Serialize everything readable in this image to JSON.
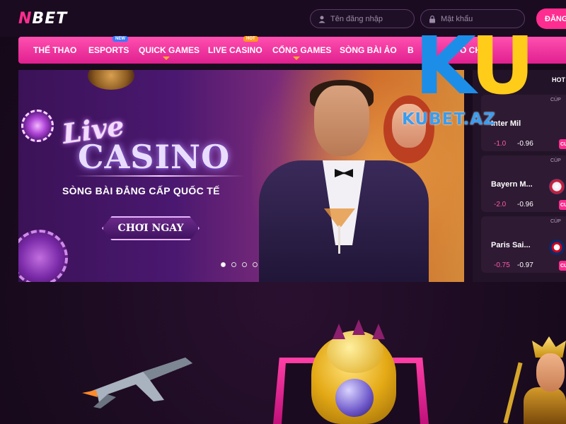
{
  "header": {
    "logo_text": "BET",
    "logo_mark": "N",
    "username_placeholder": "Tên đăng nhập",
    "password_placeholder": "Mật khẩu",
    "login_label": "ĐĂNG"
  },
  "nav": {
    "items": [
      {
        "label": "THỂ THAO"
      },
      {
        "label": "ESPORTS",
        "badge": "NEW"
      },
      {
        "label": "QUICK GAMES"
      },
      {
        "label": "LIVE CASINO",
        "badge": "HOT"
      },
      {
        "label": "CỔNG GAMES"
      },
      {
        "label": "SÒNG BÀI ẢO"
      },
      {
        "label": "B"
      },
      {
        "label": "O CHƠI"
      }
    ]
  },
  "banner": {
    "title_script": "Live",
    "title_main": "CASINO",
    "subtitle": "SÒNG BÀI ĐẲNG CẤP QUỐC TẾ",
    "cta_label": "CHƠI NGAY",
    "slide_count": 4,
    "active_slide": 1
  },
  "hot_panel": {
    "title": "HOT",
    "matches": [
      {
        "cup": "CÚP",
        "team": "Inter Mil",
        "odd_handicap": "-1.0",
        "odd_value": "-0.96",
        "bet_label": "CƯ"
      },
      {
        "cup": "CÚP",
        "team": "Bayern M...",
        "odd_handicap": "-2.0",
        "odd_value": "-0.96",
        "bet_label": "CƯ"
      },
      {
        "cup": "CÚP",
        "team": "Paris Sai...",
        "odd_handicap": "-0.75",
        "odd_value": "-0.97",
        "bet_label": "CƯ"
      }
    ]
  },
  "watermark": {
    "brand_k": "K",
    "brand_u": "U",
    "site": "KUBET.AZ"
  },
  "colors": {
    "accent_pink": "#ff2d8f",
    "nav_gradient_top": "#ff4fb0",
    "background": "#1c0d22",
    "watermark_blue": "#1d8ee8",
    "watermark_yellow": "#ffcc1a"
  },
  "icons": {
    "username": "user-icon",
    "password": "lock-icon"
  }
}
